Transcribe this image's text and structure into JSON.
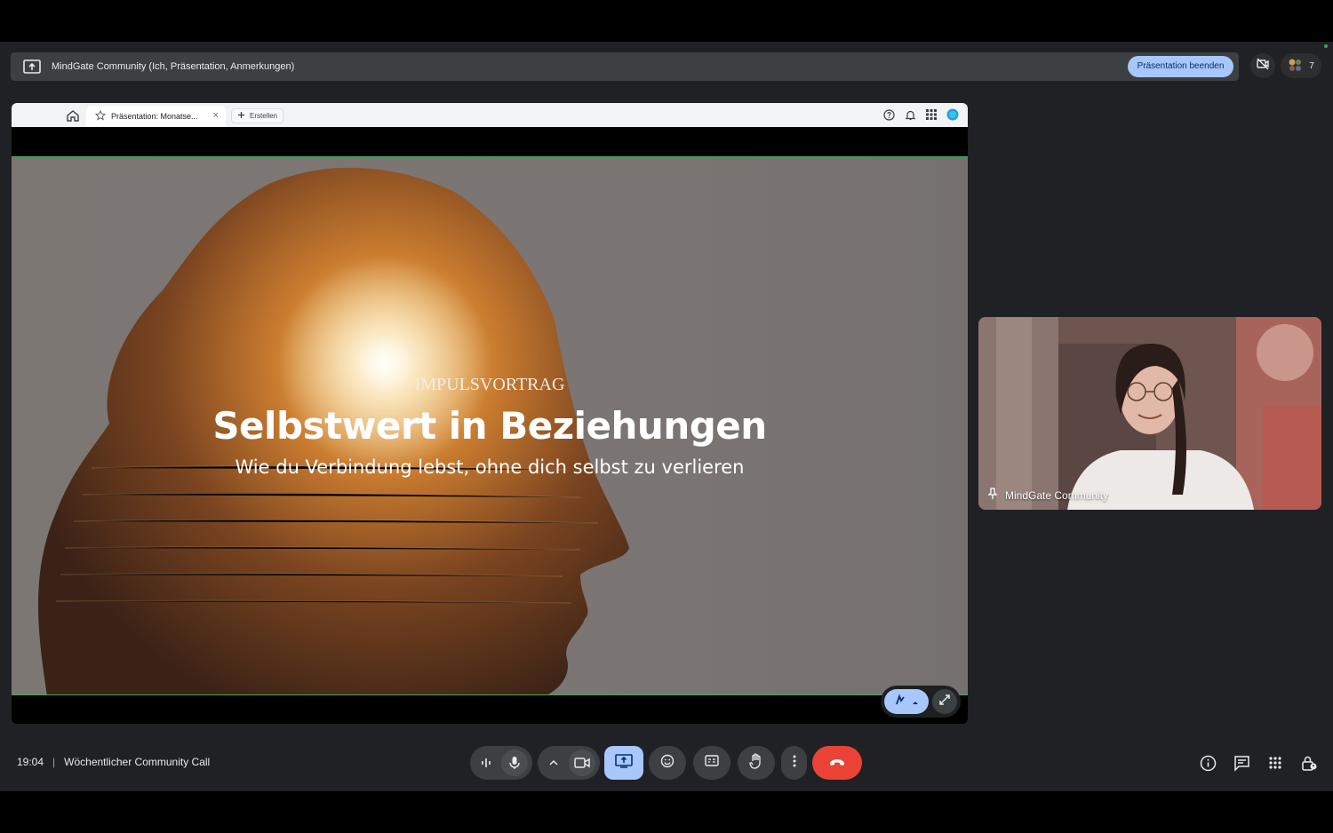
{
  "presenting_bar": {
    "title": "MindGate Community (Ich, Präsentation, Anmerkungen)",
    "stop_button": "Präsentation beenden",
    "participant_count": "7"
  },
  "browser": {
    "tab_title": "Präsentation: Monatse...",
    "tab_close": "×",
    "new_button": "Erstellen"
  },
  "slide": {
    "kicker": "IMPULSVORTRAG",
    "title": "Selbstwert in Beziehungen",
    "subtitle": "Wie du Verbindung lebst, ohne dich selbst zu verlieren"
  },
  "self_view": {
    "name": "MindGate Community"
  },
  "meeting": {
    "time": "19:04",
    "separator": "|",
    "title": "Wöchentlicher Community Call"
  },
  "colors": {
    "accent": "#a8c7fa",
    "end_call": "#ea4335",
    "bar": "#3c4043",
    "background": "#202124"
  }
}
